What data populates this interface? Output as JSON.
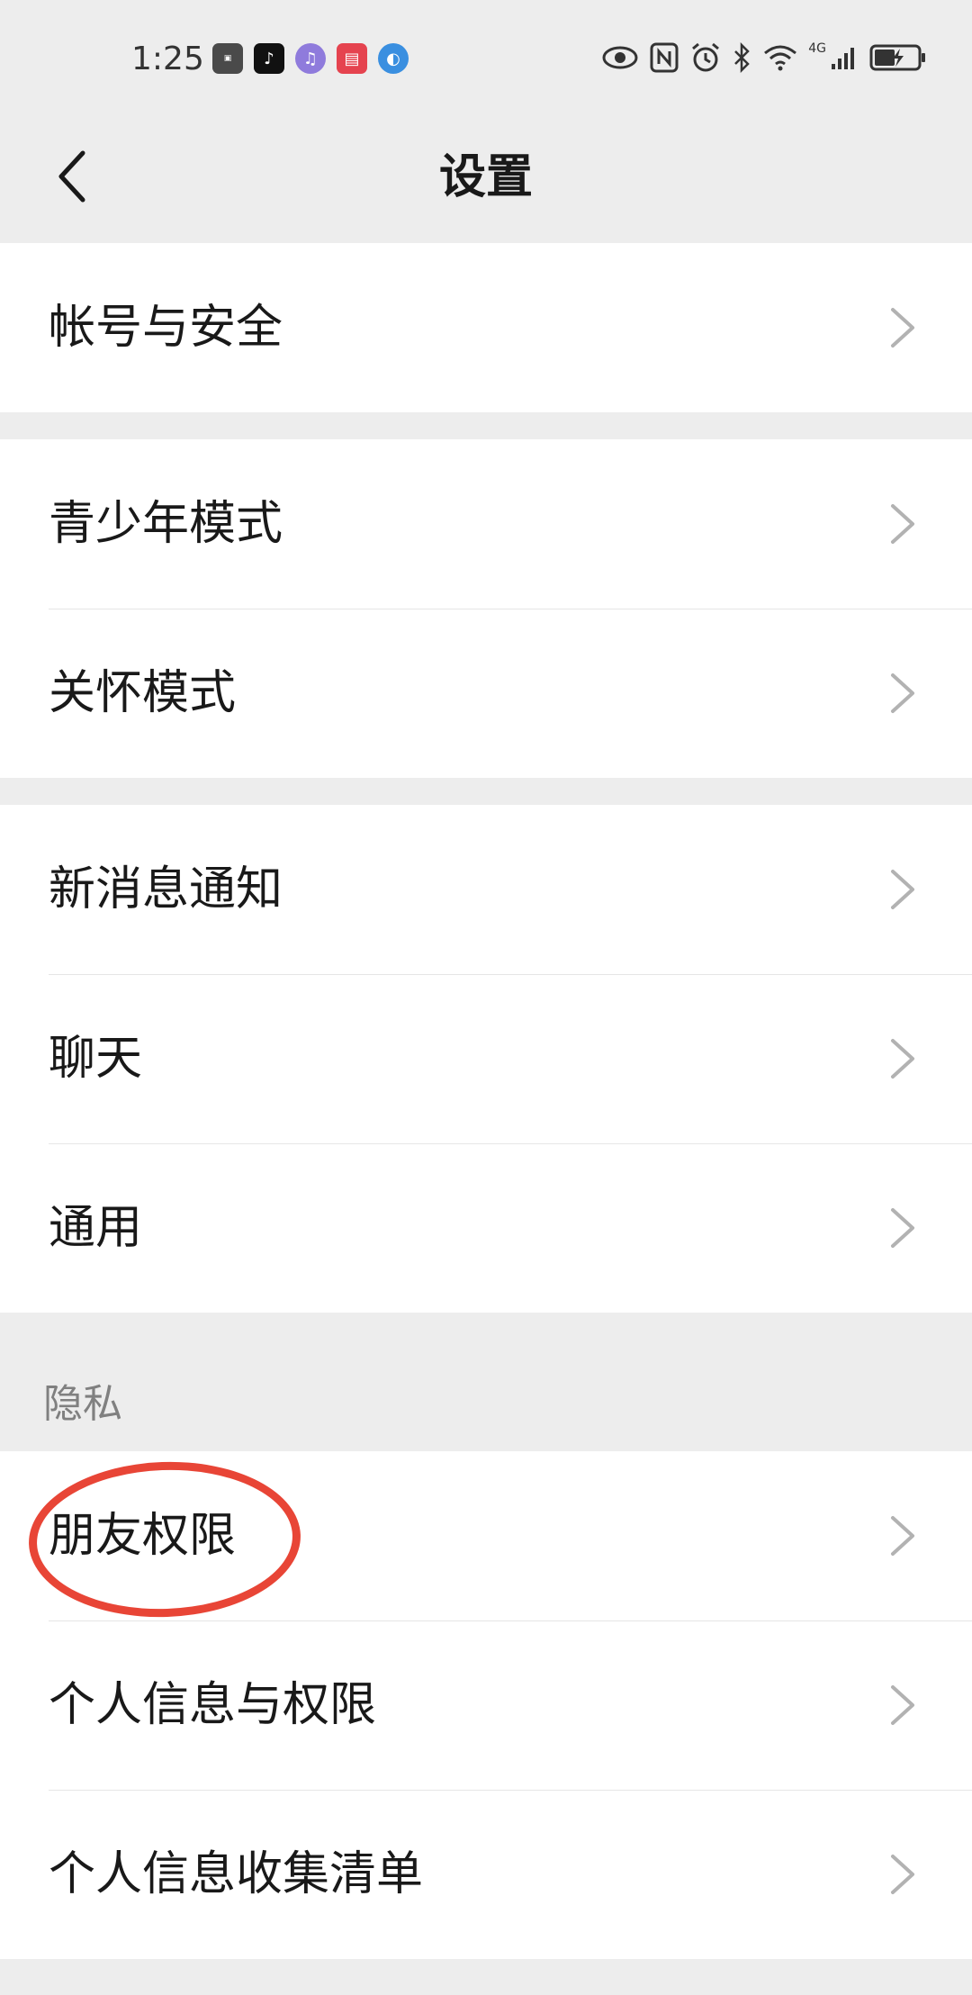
{
  "status_bar": {
    "time": "1:25",
    "network": "4G"
  },
  "header": {
    "title": "设置"
  },
  "groups": [
    {
      "items": [
        {
          "label": "帐号与安全"
        }
      ]
    },
    {
      "items": [
        {
          "label": "青少年模式"
        },
        {
          "label": "关怀模式"
        }
      ]
    },
    {
      "items": [
        {
          "label": "新消息通知"
        },
        {
          "label": "聊天"
        },
        {
          "label": "通用"
        }
      ]
    },
    {
      "section": "隐私",
      "items": [
        {
          "label": "朋友权限"
        },
        {
          "label": "个人信息与权限"
        },
        {
          "label": "个人信息收集清单"
        }
      ]
    }
  ],
  "annotation": {
    "color": "#e84536"
  }
}
